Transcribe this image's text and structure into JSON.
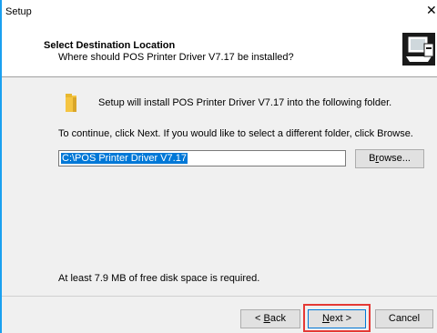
{
  "window": {
    "title": "Setup"
  },
  "header": {
    "title": "Select Destination Location",
    "subtitle": "Where should POS Printer Driver V7.17 be installed?"
  },
  "content": {
    "intro": "Setup will install POS Printer Driver V7.17 into the following folder.",
    "continue": "To continue, click Next. If you would like to select a different folder, click Browse.",
    "path_value": "C:\\POS Printer Driver V7.17",
    "browse_pre": "B",
    "browse_u": "r",
    "browse_post": "owse...",
    "disk_space": "At least 7.9 MB of free disk space is required."
  },
  "footer": {
    "back_pre": "< ",
    "back_u": "B",
    "back_post": "ack",
    "next_u": "N",
    "next_post": "ext >",
    "cancel": "Cancel"
  },
  "colors": {
    "accent": "#0078d7",
    "highlight": "#e53935"
  }
}
